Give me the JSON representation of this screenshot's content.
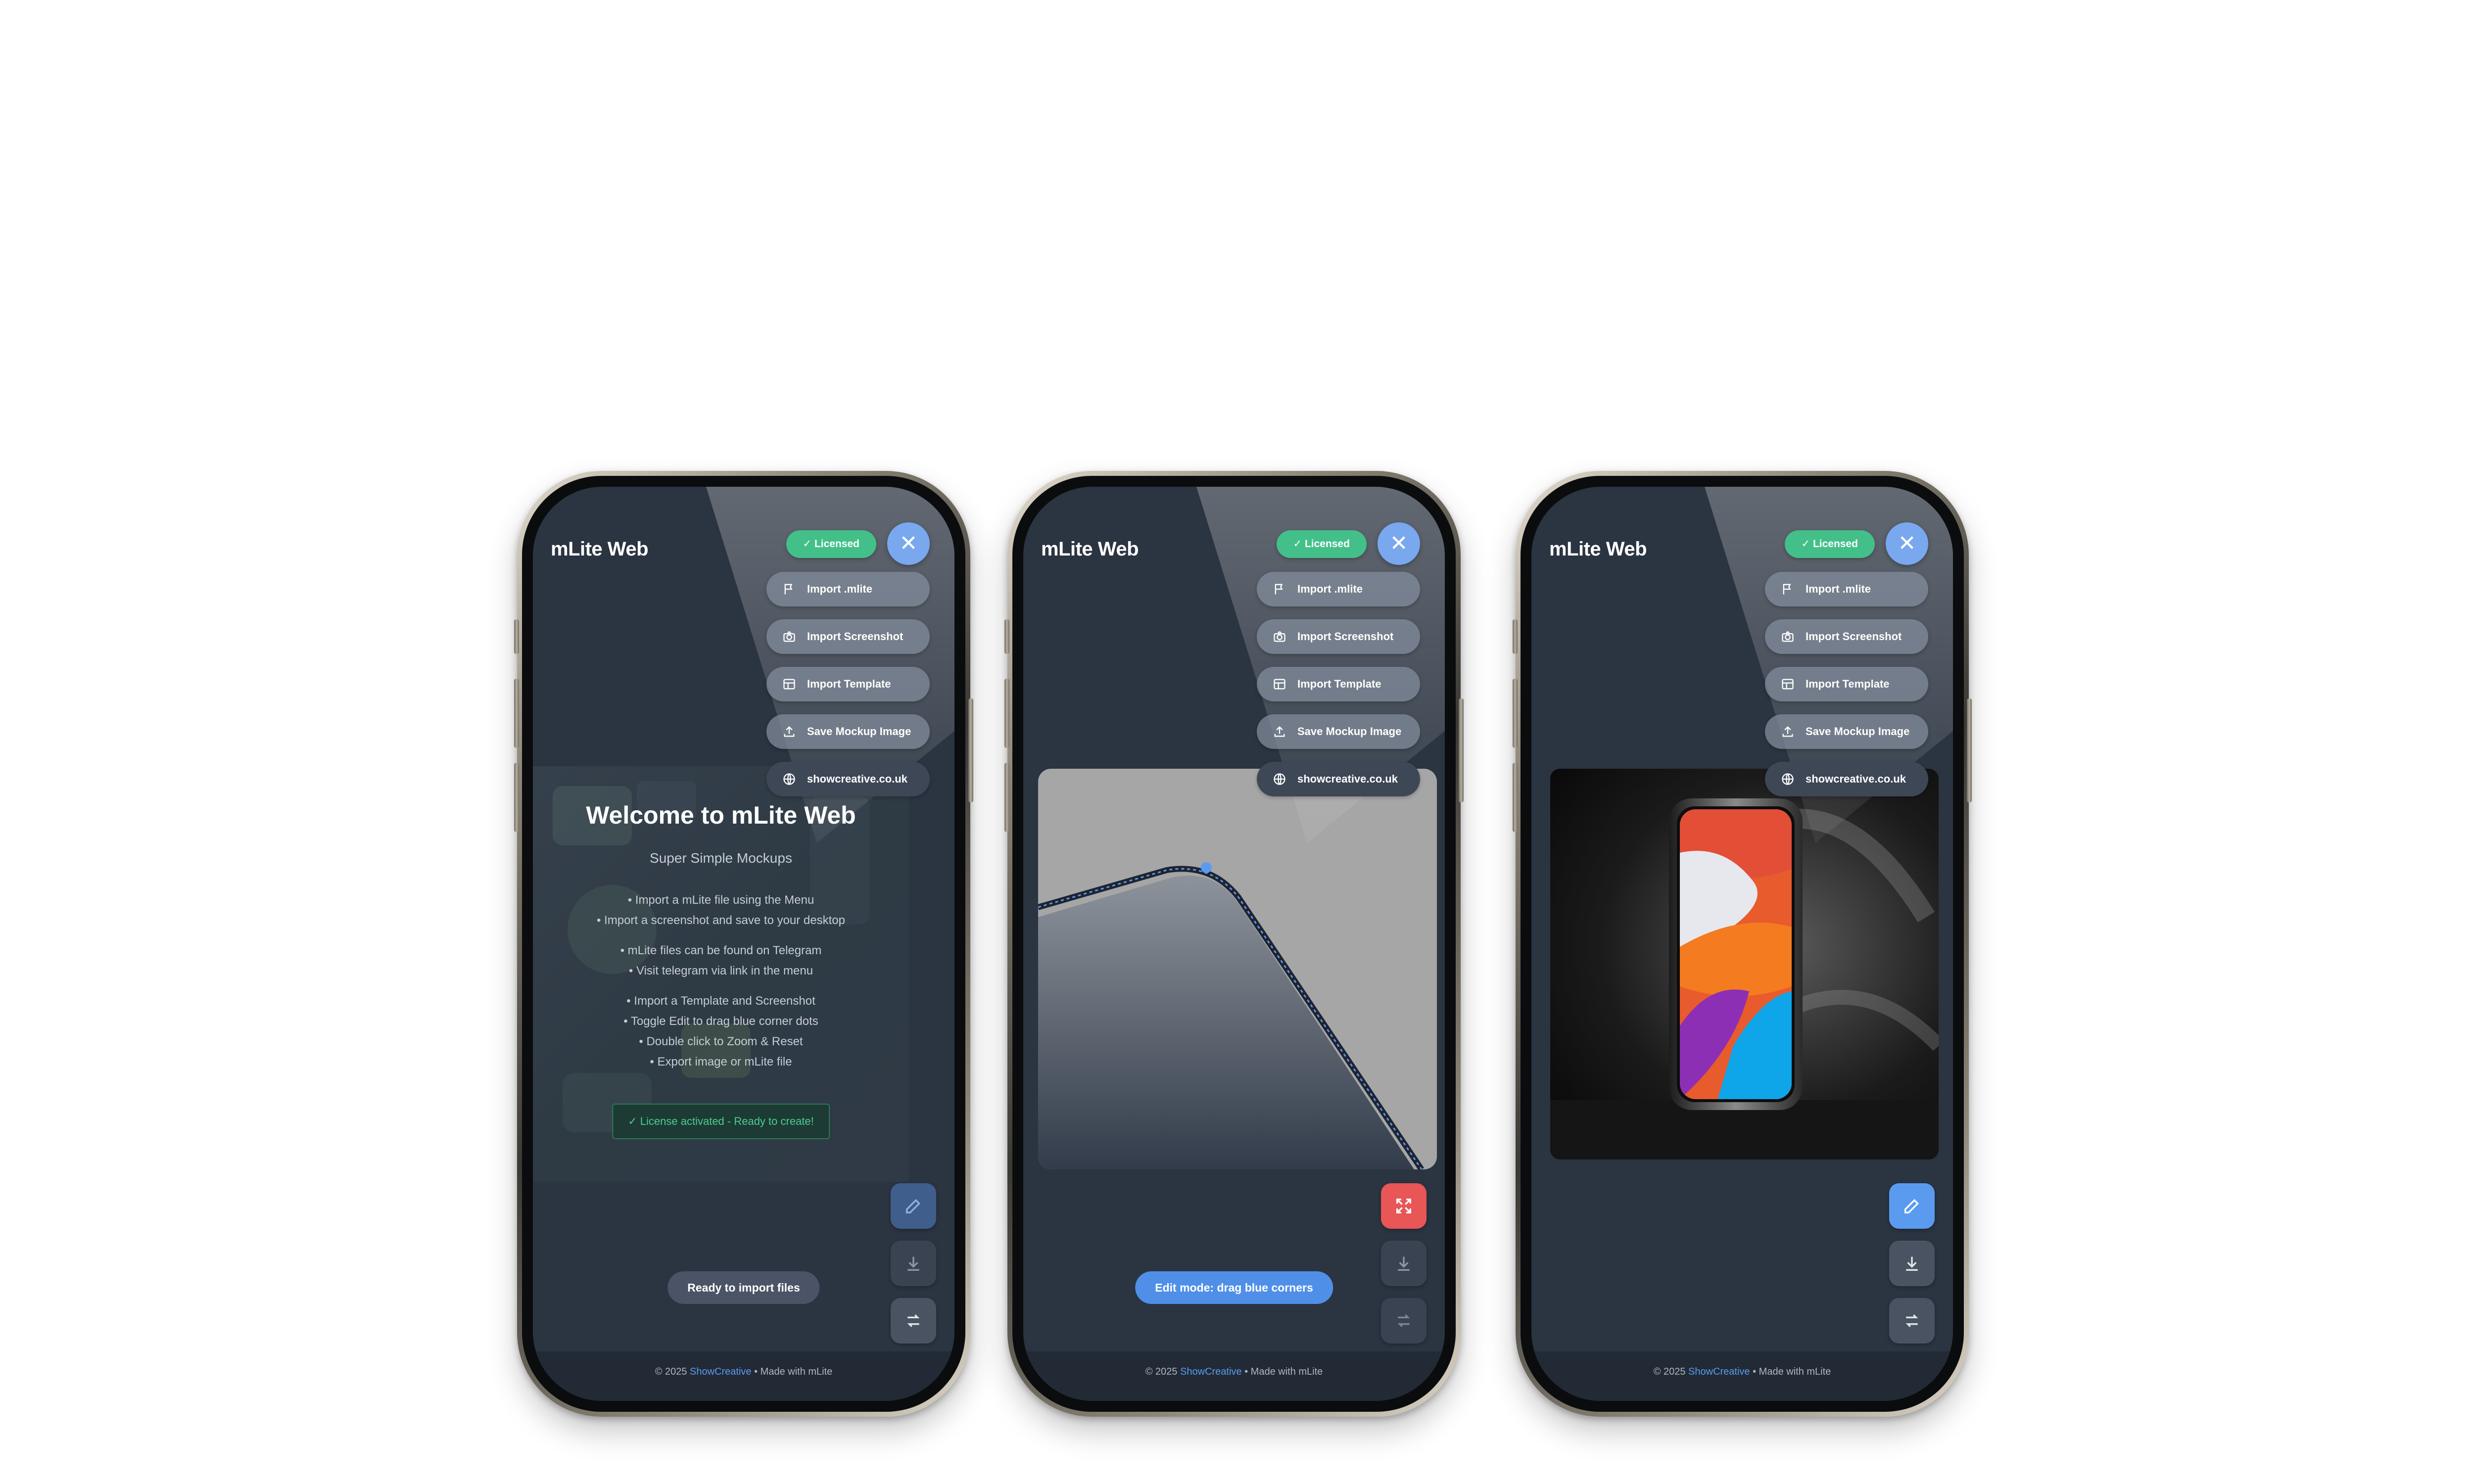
{
  "app": {
    "title": "mLite Web",
    "licensed_badge": "✓ Licensed"
  },
  "menu": {
    "items": [
      {
        "label": "Import .mlite",
        "icon": "flag-icon"
      },
      {
        "label": "Import Screenshot",
        "icon": "camera-icon"
      },
      {
        "label": "Import Template",
        "icon": "template-icon"
      },
      {
        "label": "Save Mockup Image",
        "icon": "upload-icon"
      },
      {
        "label": "showcreative.co.uk",
        "icon": "globe-icon"
      }
    ]
  },
  "welcome": {
    "title": "Welcome to mLite Web",
    "subtitle": "Super Simple Mockups",
    "tips": [
      "• Import a mLite file using the Menu",
      "• Import a screenshot and save to your desktop",
      "• mLite files can be found on Telegram",
      "• Visit telegram via link in the menu",
      "• Import a Template and Screenshot",
      "• Toggle Edit to drag blue corner dots",
      "• Double click to Zoom & Reset",
      "• Export image or mLite file"
    ],
    "license_status": "✓ License activated - Ready to create!"
  },
  "status": {
    "ready": "Ready to import files",
    "edit_mode": "Edit mode: drag blue corners"
  },
  "footer": {
    "copyright": "© 2025 ",
    "brand": "ShowCreative",
    "suffix": " • Made with mLite"
  },
  "colors": {
    "accent": "#5a9bf0",
    "licensed": "#43c089",
    "danger": "#e85656",
    "background": "#2b3441"
  }
}
